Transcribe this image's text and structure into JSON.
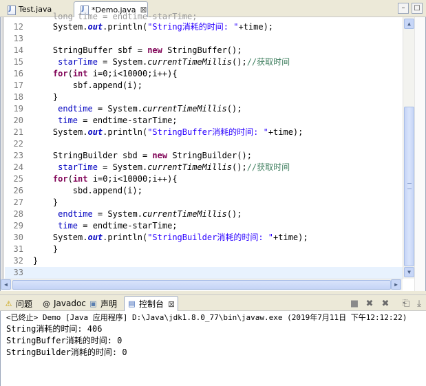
{
  "editor_tabs": [
    {
      "label": "Test.java",
      "active": false
    },
    {
      "label": "*Demo.java",
      "active": true
    }
  ],
  "tab_close_glyph": "⊠",
  "window_controls": {
    "minimize": "–",
    "maximize": "□"
  },
  "code": {
    "partial_top": "long time = endtime-starTime;",
    "lines": [
      {
        "n": "12"
      },
      {
        "n": "13"
      },
      {
        "n": "14"
      },
      {
        "n": "15"
      },
      {
        "n": "16"
      },
      {
        "n": "17"
      },
      {
        "n": "18"
      },
      {
        "n": "19"
      },
      {
        "n": "20"
      },
      {
        "n": "21"
      },
      {
        "n": "22"
      },
      {
        "n": "23"
      },
      {
        "n": "24"
      },
      {
        "n": "25"
      },
      {
        "n": "26"
      },
      {
        "n": "27"
      },
      {
        "n": "28"
      },
      {
        "n": "29"
      },
      {
        "n": "30"
      },
      {
        "n": "31"
      },
      {
        "n": "32"
      },
      {
        "n": "33"
      }
    ],
    "t": {
      "sys": "System.",
      "out": "out",
      "println": ".println(",
      "s_string": "\"String消耗的时间: \"",
      "s_buffer": "\"StringBuffer消耗的时间: \"",
      "s_builder": "\"StringBuilder消耗的时间: \"",
      "plus_time": "+time);",
      "sb_decl": "StringBuffer sbf = ",
      "new": "new",
      "sb_ctor": " StringBuffer();",
      "sbd_decl": "StringBuilder sbd = ",
      "sbd_ctor": " StringBuilder();",
      "star": "starTime",
      "assign": " = System.",
      "ctm": "currentTimeMillis",
      "call_end": "();",
      "comment": "//获取时间",
      "for": "for",
      "int": "int",
      "loop": " i=0;i<10000;i++){",
      "open": "(",
      "sbf_append": "sbf.append(i);",
      "sbd_append": "sbd.append(i);",
      "close_brace": "}",
      "endtime": "endtime",
      "time": "time",
      "time_assign": " = endtime-starTime;"
    }
  },
  "panel_tabs": [
    {
      "icon": "⚠",
      "label": "问题"
    },
    {
      "icon": "@",
      "label": "Javadoc"
    },
    {
      "icon": "▣",
      "label": "声明"
    },
    {
      "icon": "▤",
      "label": "控制台"
    }
  ],
  "panel_close_glyph": "⊠",
  "console": {
    "header": "<已终止> Demo [Java 应用程序] D:\\Java\\jdk1.8.0_77\\bin\\javaw.exe (2019年7月11日 下午12:12:22)",
    "output": [
      "String消耗的时间: 406",
      "StringBuffer消耗的时间: 0",
      "StringBuilder消耗的时间: 0"
    ]
  },
  "toolbar_glyphs": {
    "terminate": "■",
    "remove": "✖",
    "remove_all": "✖",
    "pin": "⎗",
    "scroll_lock": "⤓"
  }
}
